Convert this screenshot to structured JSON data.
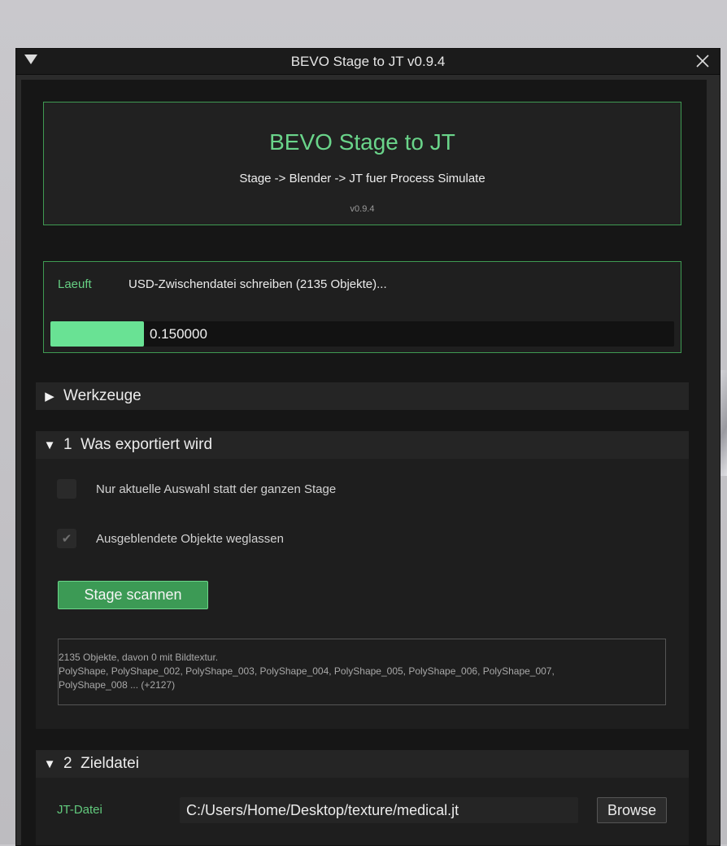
{
  "window": {
    "title": "BEVO Stage to JT v0.9.4"
  },
  "header": {
    "title": "BEVO Stage to JT",
    "subtitle": "Stage -> Blender -> JT fuer Process Simulate",
    "version": "v0.9.4"
  },
  "status": {
    "label": "Laeuft",
    "message": "USD-Zwischendatei schreiben (2135 Objekte)...",
    "progress_value": 0.15,
    "progress_text": "0.150000"
  },
  "sections": {
    "tools": {
      "arrow": "▶",
      "label": "Werkzeuge",
      "expanded": false
    },
    "export": {
      "arrow": "▼",
      "label": "1  Was exportiert wird",
      "expanded": true,
      "option_selection": {
        "label": "Nur aktuelle Auswahl statt der ganzen Stage",
        "checked": false
      },
      "option_hidden": {
        "label": "Ausgeblendete Objekte weglassen",
        "checked": true
      },
      "scan_button": "Stage scannen",
      "result_lines": [
        "2135 Objekte, davon 0 mit Bildtextur.",
        "PolyShape, PolyShape_002, PolyShape_003, PolyShape_004, PolyShape_005, PolyShape_006, PolyShape_007,",
        "PolyShape_008 ... (+2127)"
      ]
    },
    "target": {
      "arrow": "▼",
      "label": "2  Zieldatei",
      "expanded": true,
      "jt_label": "JT-Datei",
      "jt_path": "C:/Users/Home/Desktop/texture/medical.jt",
      "browse_button": "Browse"
    }
  },
  "colors": {
    "accent_green": "#6ad48a",
    "border_green": "#3f9a52",
    "progress_fill": "#69e294",
    "button_green": "#3c9a55"
  },
  "icons": {
    "collapse": "triangle-down-icon",
    "close": "close-icon",
    "check": "checkmark-icon"
  }
}
